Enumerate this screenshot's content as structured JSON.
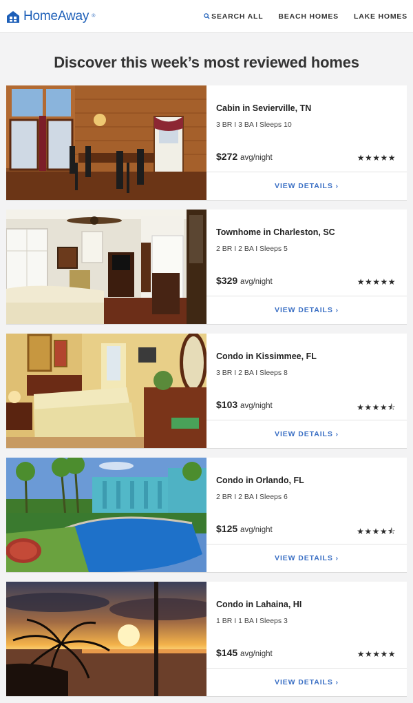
{
  "header": {
    "logo_text": "HomeAway",
    "logo_tm": "®",
    "nav": [
      {
        "label": "SEARCH ALL",
        "icon": "search-icon"
      },
      {
        "label": "BEACH HOMES"
      },
      {
        "label": "LAKE HOMES"
      }
    ]
  },
  "main": {
    "headline": "Discover this week’s most reviewed homes"
  },
  "listings": [
    {
      "title": "Cabin in Sevierville, TN",
      "specs": "3 BR  I  3 BA  I  Sleeps 10",
      "price": "$272",
      "price_unit": "avg/night",
      "rating": 5,
      "stars": "★★★★★",
      "details_label": "VIEW DETAILS ›",
      "photo": "cabin-dining-room"
    },
    {
      "title": "Townhome in Charleston, SC",
      "specs": "2 BR  I  2 BA  I  Sleeps 5",
      "price": "$329",
      "price_unit": "avg/night",
      "rating": 5,
      "stars": "★★★★★",
      "details_label": "VIEW DETAILS ›",
      "photo": "townhome-bedroom"
    },
    {
      "title": "Condo in Kissimmee, FL",
      "specs": "3 BR  I  2 BA  I  Sleeps 8",
      "price": "$103",
      "price_unit": "avg/night",
      "rating": 4.5,
      "stars": "★★★★⯪",
      "details_label": "VIEW DETAILS ›",
      "photo": "condo-bedroom"
    },
    {
      "title": "Condo in Orlando, FL",
      "specs": "2 BR  I  2 BA  I  Sleeps 6",
      "price": "$125",
      "price_unit": "avg/night",
      "rating": 4.5,
      "stars": "★★★★⯪",
      "details_label": "VIEW DETAILS ›",
      "photo": "resort-pool"
    },
    {
      "title": "Condo in Lahaina, HI",
      "specs": "1 BR  I  1 BA  I  Sleeps 3",
      "price": "$145",
      "price_unit": "avg/night",
      "rating": 5,
      "stars": "★★★★★",
      "details_label": "VIEW DETAILS ›",
      "photo": "sunset-palms"
    }
  ]
}
